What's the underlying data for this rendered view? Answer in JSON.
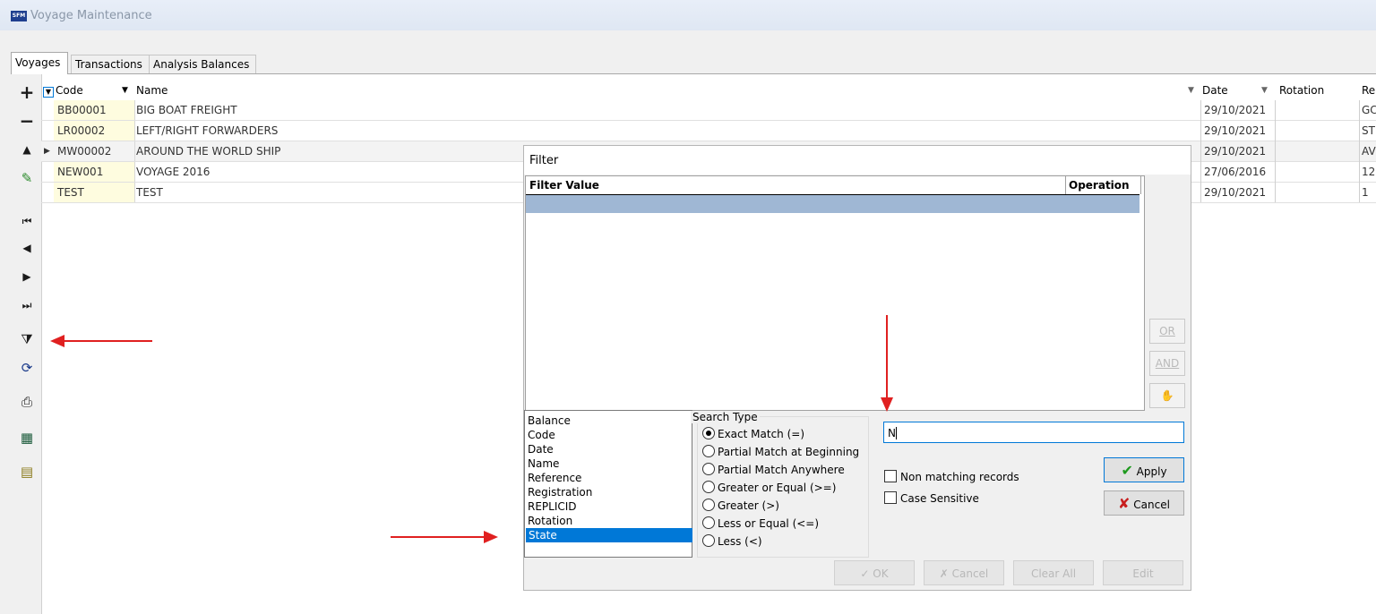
{
  "window": {
    "title": "Voyage Maintenance",
    "logo_text": "SFM"
  },
  "tabs": [
    "Voyages",
    "Transactions",
    "Analysis Balances"
  ],
  "grid": {
    "headers": {
      "code": "Code",
      "name": "Name",
      "date": "Date",
      "rotation": "Rotation",
      "reference": "Re"
    },
    "rows": [
      {
        "code": "BB00001",
        "name": "BIG BOAT FREIGHT",
        "date": "29/10/2021",
        "rotation": "",
        "reference": "GC"
      },
      {
        "code": "LR00002",
        "name": "LEFT/RIGHT FORWARDERS",
        "date": "29/10/2021",
        "rotation": "",
        "reference": "ST"
      },
      {
        "code": "MW00002",
        "name": "AROUND THE WORLD SHIP",
        "date": "29/10/2021",
        "rotation": "",
        "reference": "AV"
      },
      {
        "code": "NEW001",
        "name": "VOYAGE 2016",
        "date": "27/06/2016",
        "rotation": "",
        "reference": "12"
      },
      {
        "code": "TEST",
        "name": "TEST",
        "date": "29/10/2021",
        "rotation": "",
        "reference": "1"
      }
    ]
  },
  "filter": {
    "title": "Filter",
    "columns": {
      "value": "Filter Value",
      "operation": "Operation"
    },
    "side_buttons": [
      "OR",
      "AND"
    ],
    "fields": [
      "Balance",
      "Code",
      "Date",
      "Name",
      "Reference",
      "Registration",
      "REPLICID",
      "Rotation",
      "State"
    ],
    "selected_field": "State",
    "search_type_label": "Search Type",
    "search_types": [
      "Exact Match (=)",
      "Partial Match at Beginning",
      "Partial Match Anywhere",
      "Greater or Equal (>=)",
      "Greater (>)",
      "Less or Equal (<=)",
      "Less (<)"
    ],
    "value": "N",
    "non_matching": "Non matching records",
    "case_sensitive": "Case Sensitive",
    "apply": "Apply",
    "cancel": "Cancel",
    "bottom": {
      "ok": "OK",
      "cancel": "Cancel",
      "clear": "Clear All",
      "edit": "Edit"
    }
  },
  "colors": {
    "annotation_arrow": "#e02020",
    "selection": "#0078d7"
  }
}
